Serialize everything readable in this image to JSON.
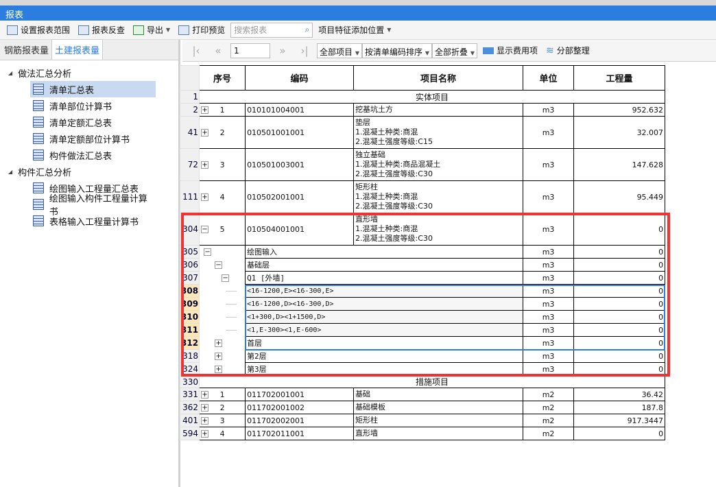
{
  "window": {
    "title": "报表"
  },
  "toolbar": {
    "set_range": "设置报表范围",
    "reverse_check": "报表反查",
    "export": "导出",
    "print_preview": "打印预览",
    "search_placeholder": "搜索报表",
    "feature_position": "项目特征添加位置"
  },
  "left_tabs": [
    "钢筋报表量",
    "土建报表量"
  ],
  "tree": [
    {
      "label": "做法汇总分析",
      "items": [
        "清单汇总表",
        "清单部位计算书",
        "清单定额汇总表",
        "清单定额部位计算书",
        "构件做法汇总表"
      ]
    },
    {
      "label": "构件汇总分析",
      "items": [
        "绘图输入工程量汇总表",
        "绘图输入构件工程量计算书",
        "表格输入工程量计算书"
      ]
    }
  ],
  "pager": {
    "page": "1",
    "filter": "全部项目",
    "sort": "按清单编码排序",
    "fold": "全部折叠",
    "show_cost": "显示费用项",
    "organize": "分部整理"
  },
  "table": {
    "headers": [
      "序号",
      "编码",
      "项目名称",
      "单位",
      "工程量"
    ],
    "rows": [
      {
        "rn": "1",
        "section": "实体项目"
      },
      {
        "rn": "2",
        "toggle": "+",
        "seq": "1",
        "code": "010101004001",
        "name": [
          "挖基坑土方"
        ],
        "unit": "m3",
        "qty": "952.632"
      },
      {
        "rn": "41",
        "toggle": "+",
        "seq": "2",
        "code": "010501001001",
        "name": [
          "垫层",
          "1.混凝土种类:商混",
          "2.混凝土强度等级:C15"
        ],
        "unit": "m3",
        "qty": "32.007"
      },
      {
        "rn": "72",
        "toggle": "+",
        "seq": "3",
        "code": "010501003001",
        "name": [
          "独立基础",
          "1.混凝土种类:商品混凝土",
          "2.混凝土强度等级:C30"
        ],
        "unit": "m3",
        "qty": "147.628"
      },
      {
        "rn": "111",
        "toggle": "+",
        "seq": "4",
        "code": "010502001001",
        "name": [
          "矩形柱",
          "1.混凝土种类:商混",
          "2.混凝土强度等级:C30"
        ],
        "unit": "m3",
        "qty": "95.449"
      },
      {
        "rn": "304",
        "toggle": "−",
        "seq": "5",
        "code": "010504001001",
        "name": [
          "直形墙",
          "1.混凝土种类:商混",
          "2.混凝土强度等级:C30"
        ],
        "unit": "m3",
        "qty": "0"
      },
      {
        "rn": "305",
        "level": 1,
        "toggle": "−",
        "label": "绘图输入",
        "unit": "m3",
        "qty": "0"
      },
      {
        "rn": "306",
        "level": 2,
        "toggle": "−",
        "label": "基础层",
        "unit": "m3",
        "qty": "0"
      },
      {
        "rn": "307",
        "level": 3,
        "toggle": "−",
        "label": "Q1 [外墙]",
        "unit": "m3",
        "qty": "0"
      },
      {
        "rn": "308",
        "level": 4,
        "label": "<16-1200,E><16-300,E>",
        "unit": "m3",
        "qty": "0",
        "hl": true
      },
      {
        "rn": "309",
        "level": 4,
        "label": "<16-1200,D><16-300,D>",
        "unit": "m3",
        "qty": "0",
        "hl": true
      },
      {
        "rn": "310",
        "level": 4,
        "label": "<1+300,D><1+1500,D>",
        "unit": "m3",
        "qty": "0",
        "hl": true
      },
      {
        "rn": "311",
        "level": 4,
        "label": "<1,E-300><1,E-600>",
        "unit": "m3",
        "qty": "0",
        "hl": true
      },
      {
        "rn": "312",
        "level": 2,
        "toggle": "+",
        "label": "首层",
        "unit": "m3",
        "qty": "0",
        "hl": true
      },
      {
        "rn": "318",
        "level": 2,
        "toggle": "+",
        "label": "第2层",
        "unit": "m3",
        "qty": "0"
      },
      {
        "rn": "324",
        "level": 2,
        "toggle": "+",
        "label": "第3层",
        "unit": "m3",
        "qty": "0"
      },
      {
        "rn": "330",
        "section": "措施项目"
      },
      {
        "rn": "331",
        "toggle": "+",
        "seq": "1",
        "code": "011702001001",
        "name": [
          "基础"
        ],
        "unit": "m2",
        "qty": "36.42"
      },
      {
        "rn": "362",
        "toggle": "+",
        "seq": "2",
        "code": "011702001002",
        "name": [
          "基础模板"
        ],
        "unit": "m2",
        "qty": "187.8"
      },
      {
        "rn": "401",
        "toggle": "+",
        "seq": "3",
        "code": "011702002001",
        "name": [
          "矩形柱"
        ],
        "unit": "m2",
        "qty": "917.3447"
      },
      {
        "rn": "594",
        "toggle": "+",
        "seq": "4",
        "code": "011702011001",
        "name": [
          "直形墙"
        ],
        "unit": "m2",
        "qty": "0"
      }
    ]
  },
  "colors": {
    "accent": "#2b7de0",
    "highlight_border": "#f03232"
  }
}
